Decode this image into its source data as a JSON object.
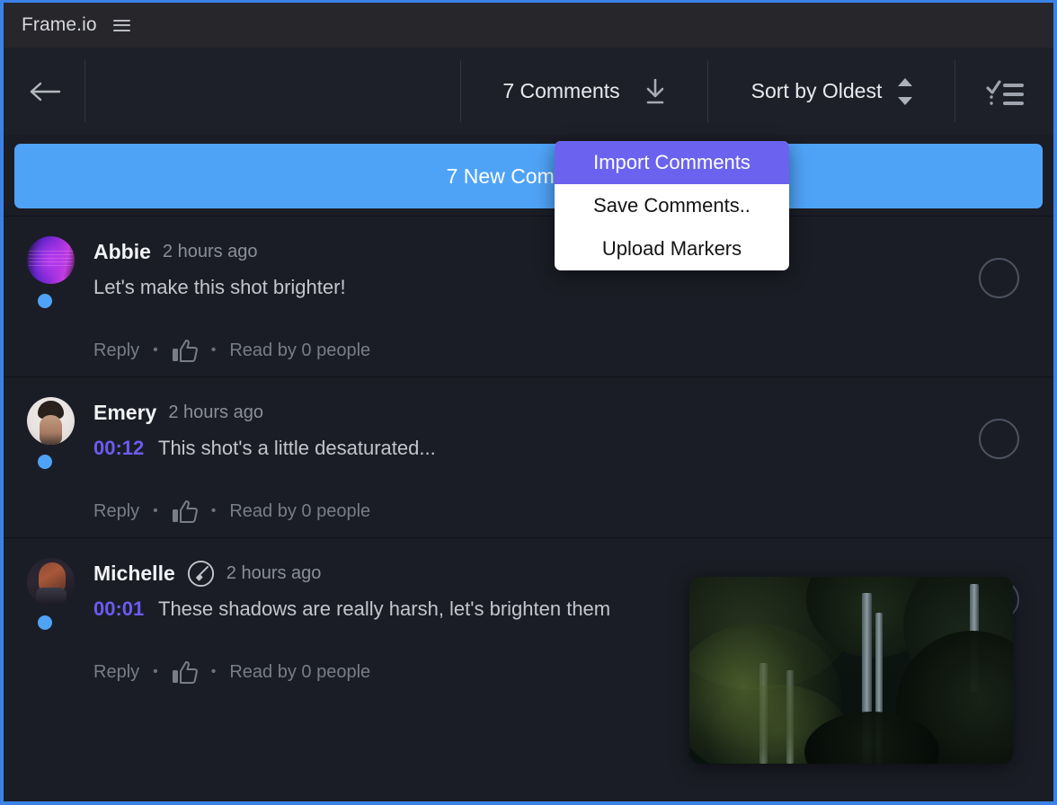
{
  "window": {
    "accent_border": "#3b82e6"
  },
  "titlebar": {
    "brand": "Frame.io",
    "menu_icon": "hamburger-icon"
  },
  "toolbar": {
    "back_icon": "arrow-left-icon",
    "comments_count_label": "7 Comments",
    "download_icon": "download-icon",
    "sort_label": "Sort by Oldest",
    "sort_icon": "sort-updown-icon",
    "checklist_icon": "checklist-icon"
  },
  "banner": {
    "label": "7 New Comments"
  },
  "dropdown": {
    "items": [
      {
        "label": "Import Comments",
        "active": true
      },
      {
        "label": "Save Comments..",
        "active": false
      },
      {
        "label": "Upload Markers",
        "active": false
      }
    ]
  },
  "actions": {
    "reply": "Reply",
    "separator": "•",
    "like_icon": "thumbs-up-icon",
    "read_by": "Read by 0 people"
  },
  "comments": [
    {
      "author": "Abbie",
      "time": "2 hours ago",
      "timecode": "",
      "text": "Let's make this shot brighter!",
      "badge": "",
      "avatar": "av-abbie",
      "unread": true,
      "selected": false
    },
    {
      "author": "Emery",
      "time": "2 hours ago",
      "timecode": "00:12",
      "text": "This shot's a little desaturated...",
      "badge": "",
      "avatar": "av-emery",
      "unread": true,
      "selected": false
    },
    {
      "author": "Michelle",
      "time": "2 hours ago",
      "timecode": "00:01",
      "text": "These shadows are really harsh, let's brighten them",
      "badge": "annotation-brush-icon",
      "avatar": "av-michelle",
      "unread": true,
      "selected": false
    }
  ],
  "thumbnail_preview": {
    "name": "forest-video-thumbnail"
  },
  "colors": {
    "accent_blue": "#4fa3f7",
    "menu_highlight": "#6b63f0",
    "timecode": "#6a5cf0",
    "panel_bg": "#1b1d26",
    "toolbar_bg": "#1e2029",
    "titlebar_bg": "#26262b"
  }
}
